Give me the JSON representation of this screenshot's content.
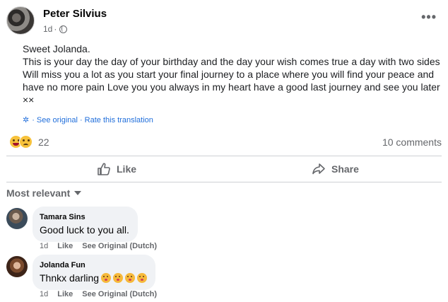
{
  "post": {
    "author": "Peter Silvius",
    "time": "1d",
    "separator": "·",
    "greeting": "Sweet Jolanda.",
    "body_lines": [
      "This is your day the day of your birthday and the day your wish comes true a day with two sides",
      "Will miss you a lot as you start your final journey to a place where you will find your peace and",
      "have no more pain Love you you always in my heart have a good last journey and see you later",
      "××"
    ],
    "see_original": "See original",
    "rate_translation": "Rate this translation",
    "translation_separator": "·",
    "reaction_count": "22",
    "comment_count": "10 comments"
  },
  "actions": {
    "like": "Like",
    "share": "Share"
  },
  "sort_label": "Most relevant",
  "comments": [
    {
      "name": "Tamara Sins",
      "text": "Good luck to you all.",
      "time": "1d",
      "like": "Like",
      "see_original": "See Original (Dutch)"
    },
    {
      "name": "Jolanda Fun",
      "text": "Thnkx darling",
      "time": "1d",
      "like": "Like",
      "see_original": "See Original (Dutch)"
    }
  ],
  "colors": {
    "link": "#216fdb",
    "secondary_text": "#65676b",
    "bubble": "#f0f2f5"
  },
  "icons": [
    "globe-icon",
    "more-icon",
    "gear-icon",
    "like-icon",
    "share-icon",
    "caret-down-icon",
    "haha-emoji",
    "sad-emoji",
    "kiss-emoji"
  ]
}
